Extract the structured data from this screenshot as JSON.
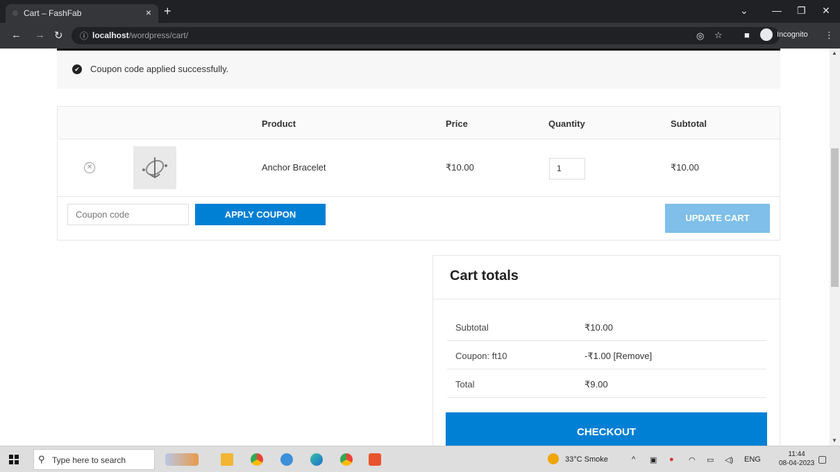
{
  "browser": {
    "tab_title": "Cart – FashFab",
    "tab_close": "×",
    "new_tab": "+",
    "url_host": "localhost",
    "url_path": "/wordpress/cart/",
    "incognito_label": "Incognito"
  },
  "notice": {
    "message": "Coupon code applied successfully."
  },
  "cart": {
    "headers": [
      "Product",
      "Price",
      "Quantity",
      "Subtotal"
    ],
    "item": {
      "name": "Anchor Bracelet",
      "price": "₹10.00",
      "quantity": "1",
      "subtotal": "₹10.00"
    },
    "coupon_placeholder": "Coupon code",
    "apply_label": "APPLY COUPON",
    "update_label": "UPDATE CART"
  },
  "totals": {
    "title": "Cart totals",
    "rows": [
      {
        "label": "Subtotal",
        "value": "₹10.00"
      },
      {
        "label": "Coupon: ft10",
        "value": "-₹1.00 [Remove]"
      },
      {
        "label": "Total",
        "value": "₹9.00"
      }
    ],
    "checkout_label": "CHECKOUT"
  },
  "taskbar": {
    "search_placeholder": "Type here to search",
    "weather": "33°C  Smoke",
    "lang": "ENG",
    "time": "11:44",
    "date": "08-04-2023"
  },
  "colors": {
    "accent": "#0080d4",
    "accent_disabled": "#7fbfe9"
  }
}
